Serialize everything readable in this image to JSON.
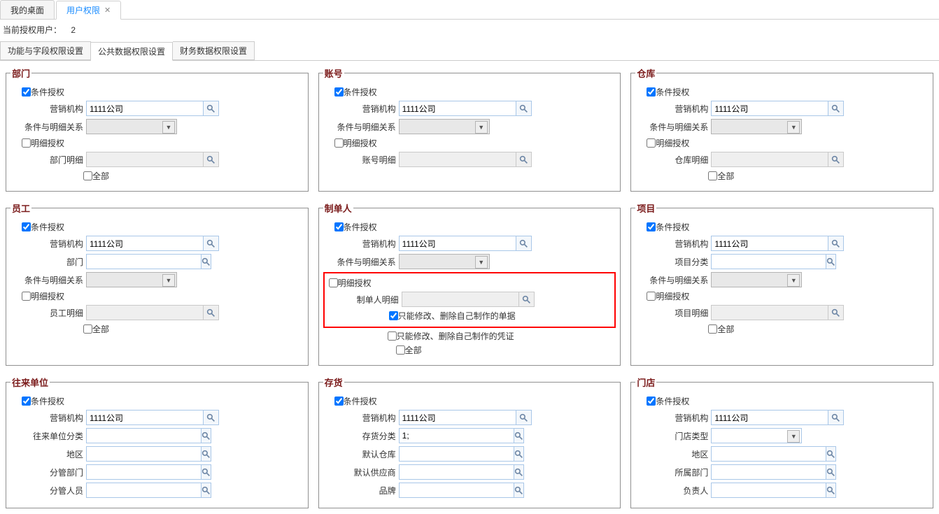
{
  "tabs": {
    "desktop": "我的桌面",
    "userperm": "用户权限"
  },
  "infoline": {
    "label": "当前授权用户：",
    "count": "2"
  },
  "subtabs": {
    "func_field": "功能与字段权限设置",
    "public_data": "公共数据权限设置",
    "finance_data": "财务数据权限设置"
  },
  "labels": {
    "cond_auth": "条件授权",
    "detail_auth": "明细授权",
    "org": "营销机构",
    "cond_relation": "条件与明细关系",
    "all": "全部",
    "dept": "部门"
  },
  "org_value": "1111公司",
  "sections": {
    "dept": {
      "title": "部门",
      "detail_label": "部门明细"
    },
    "account": {
      "title": "账号",
      "detail_label": "账号明细"
    },
    "warehouse": {
      "title": "仓库",
      "detail_label": "仓库明细"
    },
    "employee": {
      "title": "员工",
      "detail_label": "员工明细",
      "dept_label": "部门"
    },
    "maker": {
      "title": "制单人",
      "detail_label": "制单人明细",
      "own_bill": "只能修改、删除自己制作的单据",
      "own_voucher": "只能修改、删除自己制作的凭证"
    },
    "project": {
      "title": "项目",
      "detail_label": "项目明细",
      "cat_label": "项目分类"
    },
    "partner": {
      "title": "往来单位",
      "cat_label": "往来单位分类",
      "area": "地区",
      "mgr_dept": "分管部门",
      "mgr_ppl": "分管人员"
    },
    "inventory": {
      "title": "存货",
      "cat_label": "存货分类",
      "cat_value": "1;",
      "def_wh": "默认仓库",
      "def_sup": "默认供应商",
      "brand": "品牌"
    },
    "store": {
      "title": "门店",
      "type_label": "门店类型",
      "area": "地区",
      "dept": "所属部门",
      "mgr": "负责人"
    }
  }
}
